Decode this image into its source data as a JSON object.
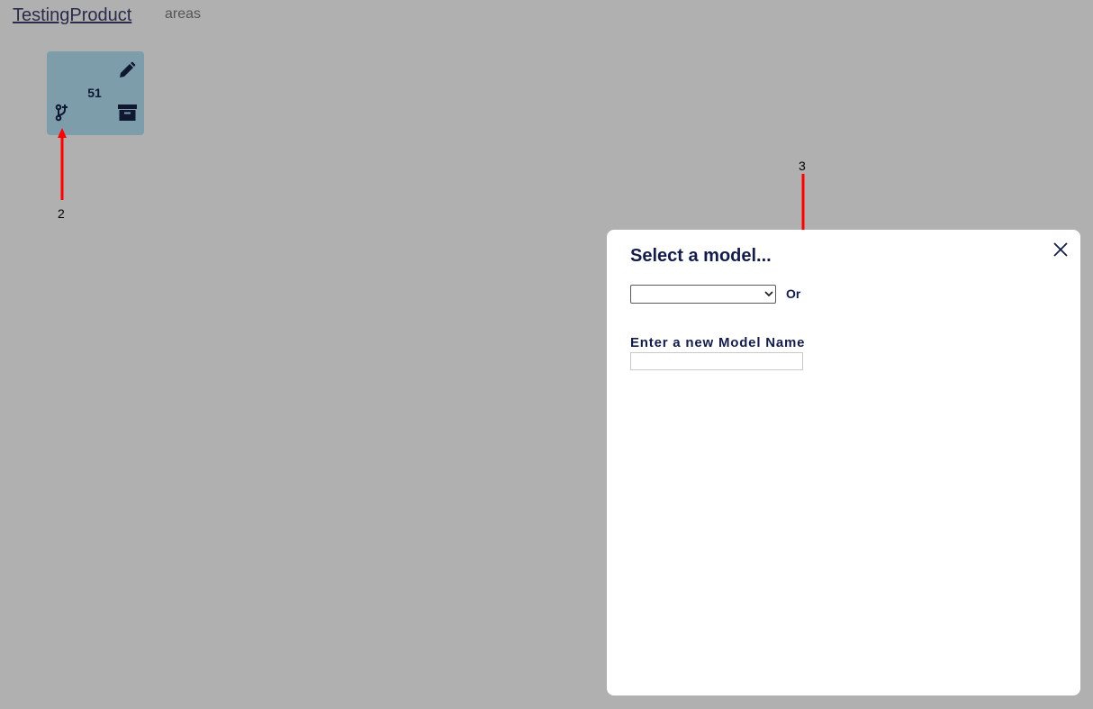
{
  "header": {
    "title": "TestingProduct",
    "subtitle": "areas"
  },
  "card": {
    "number": "51",
    "icons": [
      "edit-icon",
      "branch-icon",
      "archive-icon"
    ]
  },
  "annotations": [
    {
      "label": "2"
    },
    {
      "label": "3"
    }
  ],
  "modal": {
    "title": "Select a model...",
    "select_value": "",
    "or_label": "Or",
    "new_name_label": "Enter a new Model Name",
    "new_name_value": "",
    "close_icon": "close-icon"
  },
  "colors": {
    "background": "#b0b0b0",
    "card": "#7d9dab",
    "icon": "#0f1830",
    "modal_text": "#141d4a",
    "annotation": "#ff0000"
  }
}
